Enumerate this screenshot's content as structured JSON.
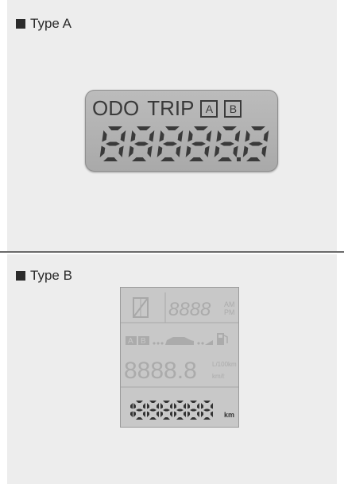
{
  "type_a": {
    "label": "Type A",
    "display": {
      "odo": "ODO",
      "trip": "TRIP",
      "trip_a": "A",
      "trip_b": "B",
      "digits": "888888"
    }
  },
  "type_b": {
    "label": "Type B",
    "display": {
      "clock": "8888",
      "am": "AM",
      "pm": "PM",
      "trip_a": "A",
      "trip_b": "B",
      "consumption": "8888.8",
      "unit_l100km": "L/100km",
      "unit_kml": "km/ℓ",
      "odometer": "1888888",
      "km_unit": "km"
    }
  },
  "colors": {
    "background": "#ffffff",
    "panel": "#ededed",
    "lcd": "#bcbcbc",
    "lcd_ink": "#3a3a3a"
  }
}
